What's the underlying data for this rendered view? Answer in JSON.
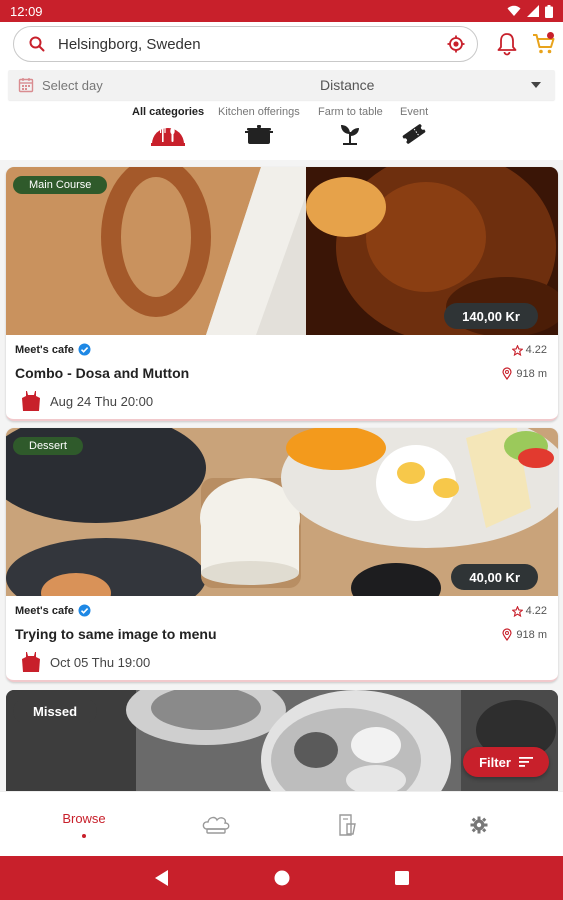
{
  "status_bar": {
    "time": "12:09"
  },
  "search": {
    "value": "Helsingborg, Sweden",
    "placeholder": "Helsingborg, Sweden"
  },
  "filters": {
    "select_day": "Select day",
    "sort": "Distance"
  },
  "categories": [
    {
      "label": "All categories",
      "icon": "restaurant-icon",
      "active": true
    },
    {
      "label": "Kitchen offerings",
      "icon": "pot-icon",
      "active": false
    },
    {
      "label": "Farm to table",
      "icon": "plant-icon",
      "active": false
    },
    {
      "label": "Event",
      "icon": "ticket-icon",
      "active": false
    }
  ],
  "listings": [
    {
      "badge": "Main Course",
      "price": "140,00 Kr",
      "vendor": "Meet's cafe",
      "rating": "4.22",
      "title": "Combo - Dosa and Mutton",
      "distance": "918 m",
      "date": "Aug 24 Thu 20:00"
    },
    {
      "badge": "Dessert",
      "price": "40,00 Kr",
      "vendor": "Meet's cafe",
      "rating": "4.22",
      "title": "Trying to same image to menu",
      "distance": "918 m",
      "date": "Oct 05 Thu 19:00"
    },
    {
      "badge": "Missed"
    }
  ],
  "filter_button": {
    "label": "Filter"
  },
  "bottom_nav": {
    "browse": "Browse"
  },
  "colors": {
    "primary": "#c8202b",
    "badge_green": "#2f5a2b",
    "price_dark": "#2f3436"
  }
}
